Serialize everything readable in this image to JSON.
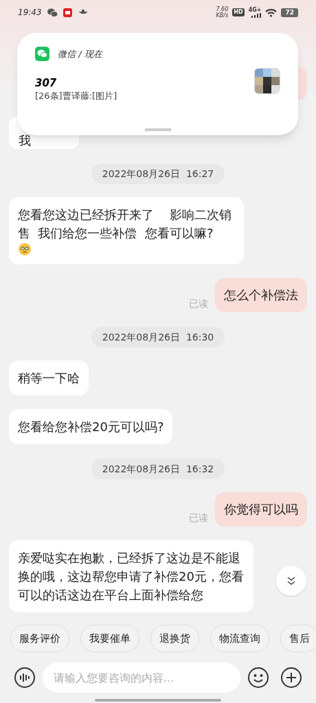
{
  "status_bar": {
    "time": "19:43",
    "net_speed": "7.60",
    "net_unit": "KB/s",
    "hd": "HD",
    "network": "4G+",
    "battery": "72"
  },
  "notification": {
    "app": "微信 / 现在",
    "title": "307",
    "body": "[26条]曹译藤:[图片]"
  },
  "messages": [
    {
      "kind": "outgoing_partial"
    },
    {
      "kind": "incoming",
      "text": "我"
    },
    {
      "kind": "time",
      "text": "2022年08月26日  16:27"
    },
    {
      "kind": "incoming",
      "text": "您看您这边已经拆开来了    影响二次销售  我们给您一些补偿  您看可以嘛?",
      "emoji": true
    },
    {
      "kind": "outgoing",
      "text": "怎么个补偿法",
      "read": "已读"
    },
    {
      "kind": "time",
      "text": "2022年08月26日  16:30"
    },
    {
      "kind": "incoming",
      "text": "稍等一下哈"
    },
    {
      "kind": "incoming",
      "text": "您看给您补偿20元可以吗?"
    },
    {
      "kind": "time",
      "text": "2022年08月26日  16:32"
    },
    {
      "kind": "outgoing",
      "text": "你觉得可以吗",
      "read": "已读"
    },
    {
      "kind": "incoming",
      "text": "亲爱哒实在抱歉，已经拆了这边是不能退换的哦，这边帮您申请了补偿20元，您看可以的话这边在平台上面补偿给您"
    }
  ],
  "quick_replies": [
    "服务评价",
    "我要催单",
    "退换货",
    "物流查询",
    "售后"
  ],
  "input": {
    "placeholder": "请输入您要咨询的内容..."
  }
}
